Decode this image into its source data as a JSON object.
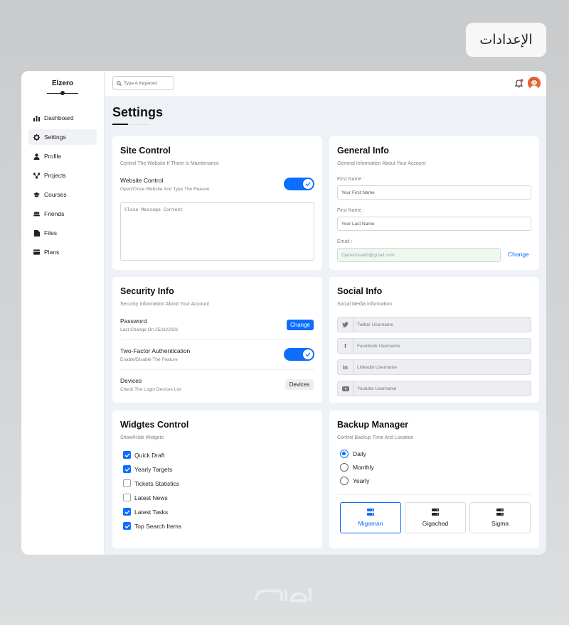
{
  "corner_tag": "الإعدادات",
  "app": {
    "brand": "Elzero"
  },
  "sidebar": {
    "items": [
      {
        "label": "Dashboard",
        "icon": "chart-bar-icon"
      },
      {
        "label": "Settings",
        "icon": "gear-icon"
      },
      {
        "label": "Profile",
        "icon": "user-icon"
      },
      {
        "label": "Projects",
        "icon": "diagram-icon"
      },
      {
        "label": "Courses",
        "icon": "graduation-cap-icon"
      },
      {
        "label": "Friends",
        "icon": "users-icon"
      },
      {
        "label": "Files",
        "icon": "file-icon"
      },
      {
        "label": "Plans",
        "icon": "credit-card-icon"
      }
    ],
    "active": "Settings"
  },
  "topbar": {
    "search_placeholder": "Type A Keyword",
    "notification_dot_color": "#f44336"
  },
  "page": {
    "title": "Settings"
  },
  "site_control": {
    "title": "Site Control",
    "subtitle": "Control The Website If There Is Maintenance",
    "row_title": "Website Control",
    "row_sub": "Open/Close Website And Type The Reason",
    "toggle_on": true,
    "textarea_placeholder": "Close Message Content"
  },
  "general_info": {
    "title": "General Info",
    "subtitle": "General Information About Your Account",
    "first_name_label": "First Name :",
    "first_name_placeholder": "Your First Name",
    "last_name_label": "First Name :",
    "last_name_placeholder": "Your Last Name",
    "email_label": "Email :",
    "email_value": "Djaberlouati0@gmail.com",
    "change_label": "Change"
  },
  "security_info": {
    "title": "Security Info",
    "subtitle": "Security Information About Your Account",
    "password_title": "Password",
    "password_sub": "Last Change On 25/10/2021",
    "password_button": "Change",
    "twofa_title": "Two-Factor Authentication",
    "twofa_sub": "Enable/Disable The Feature",
    "twofa_on": true,
    "devices_title": "Devices",
    "devices_sub": "Check The Login Devices List",
    "devices_button": "Devices"
  },
  "social_info": {
    "title": "Social Info",
    "subtitle": "Social Media Information",
    "fields": [
      {
        "icon": "twitter-icon",
        "glyph": "t",
        "placeholder": "Twitter Username"
      },
      {
        "icon": "facebook-icon",
        "glyph": "f",
        "placeholder": "Facebook Username"
      },
      {
        "icon": "linkedin-icon",
        "glyph": "in",
        "placeholder": "Linkedin Username"
      },
      {
        "icon": "youtube-icon",
        "glyph": "▶",
        "placeholder": "Youtube Username"
      }
    ]
  },
  "widgets_control": {
    "title": "Widgtes Control",
    "subtitle": "Show/Hide Widgets",
    "items": [
      {
        "label": "Quick Draft",
        "checked": true
      },
      {
        "label": "Yearly Targets",
        "checked": true
      },
      {
        "label": "Tickets Statistics",
        "checked": false
      },
      {
        "label": "Latest News",
        "checked": false
      },
      {
        "label": "Latest Tasks",
        "checked": true
      },
      {
        "label": "Top Search Items",
        "checked": true
      }
    ]
  },
  "backup_manager": {
    "title": "Backup Manager",
    "subtitle": "Control Backup Time And Location",
    "options": [
      {
        "label": "Daily",
        "selected": true
      },
      {
        "label": "Monthly",
        "selected": false
      },
      {
        "label": "Yearly",
        "selected": false
      }
    ],
    "servers": [
      {
        "label": "Migaman",
        "selected": true
      },
      {
        "label": "Gigachad",
        "selected": false
      },
      {
        "label": "Sigma",
        "selected": false
      }
    ]
  },
  "colors": {
    "accent": "#0d6efd",
    "background": "#eef2f7"
  }
}
